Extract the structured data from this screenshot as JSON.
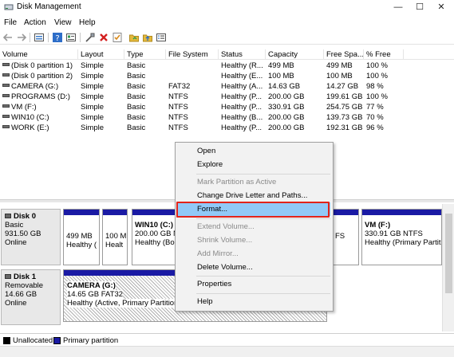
{
  "window": {
    "title": "Disk Management",
    "controls": [
      "—",
      "☐",
      "✕"
    ]
  },
  "menu": [
    "File",
    "Action",
    "View",
    "Help"
  ],
  "toolbar": {
    "icons": [
      "back-arrow-icon",
      "forward-arrow-icon",
      "disk-list-icon",
      "help-icon",
      "properties-icon",
      "connect-icon",
      "delete-icon",
      "check-icon",
      "folder-icon",
      "folder-up-icon",
      "list-icon"
    ],
    "colors": {
      "delete": "#d32020",
      "check": "#d98a1c",
      "folder": "#e5b93a",
      "help": "#2e6ec8"
    }
  },
  "volume_table": {
    "headers": [
      "Volume",
      "Layout",
      "Type",
      "File System",
      "Status",
      "Capacity",
      "Free Spa...",
      "% Free"
    ],
    "rows": [
      [
        "(Disk 0 partition 1)",
        "Simple",
        "Basic",
        "",
        "Healthy (R...",
        "499 MB",
        "499 MB",
        "100 %"
      ],
      [
        "(Disk 0 partition 2)",
        "Simple",
        "Basic",
        "",
        "Healthy (E...",
        "100 MB",
        "100 MB",
        "100 %"
      ],
      [
        "CAMERA (G:)",
        "Simple",
        "Basic",
        "FAT32",
        "Healthy (A...",
        "14.63 GB",
        "14.27 GB",
        "98 %"
      ],
      [
        "PROGRAMS (D:)",
        "Simple",
        "Basic",
        "NTFS",
        "Healthy (P...",
        "200.00 GB",
        "199.61 GB",
        "100 %"
      ],
      [
        "VM (F:)",
        "Simple",
        "Basic",
        "NTFS",
        "Healthy (P...",
        "330.91 GB",
        "254.75 GB",
        "77 %"
      ],
      [
        "WIN10 (C:)",
        "Simple",
        "Basic",
        "NTFS",
        "Healthy (B...",
        "200.00 GB",
        "139.73 GB",
        "70 %"
      ],
      [
        "WORK (E:)",
        "Simple",
        "Basic",
        "NTFS",
        "Healthy (P...",
        "200.00 GB",
        "192.31 GB",
        "96 %"
      ]
    ]
  },
  "disks": [
    {
      "name": "Disk 0",
      "type": "Basic",
      "size": "931.50 GB",
      "status": "Online",
      "partitions": [
        {
          "line1": "",
          "line2": "499 MB",
          "line3": "Healthy ("
        },
        {
          "line1": "",
          "line2": "100 M",
          "line3": "Healt"
        },
        {
          "line1": "WIN10 (C:)",
          "line2": "200.00 GB N",
          "line3": "Healthy (Boc"
        },
        {
          "line1": "",
          "line2": "FS",
          "line3": ""
        },
        {
          "line1": "VM  (F:)",
          "line2": "330.91 GB NTFS",
          "line3": "Healthy (Primary Partit"
        }
      ]
    },
    {
      "name": "Disk 1",
      "type": "Removable",
      "size": "14.66 GB",
      "status": "Online",
      "partitions": [
        {
          "line1": "CAMERA  (G:)",
          "line2": "14.65 GB FAT32",
          "line3": "Healthy (Active, Primary Partition"
        }
      ]
    }
  ],
  "legend": [
    {
      "label": "Unallocated",
      "color": "#000000"
    },
    {
      "label": "Primary partition",
      "color": "#1a1aa4"
    }
  ],
  "context_menu": {
    "items": [
      {
        "label": "Open",
        "enabled": true
      },
      {
        "label": "Explore",
        "enabled": true
      },
      {
        "label": "Mark Partition as Active",
        "enabled": false
      },
      {
        "label": "Change Drive Letter and Paths...",
        "enabled": true
      },
      {
        "label": "Format...",
        "enabled": true,
        "selected": true
      },
      {
        "label": "Extend Volume...",
        "enabled": false
      },
      {
        "label": "Shrink Volume...",
        "enabled": false
      },
      {
        "label": "Add Mirror...",
        "enabled": false
      },
      {
        "label": "Delete Volume...",
        "enabled": true
      },
      {
        "label": "Properties",
        "enabled": true
      },
      {
        "label": "Help",
        "enabled": true
      }
    ],
    "highlight_color": "#e2231a"
  }
}
